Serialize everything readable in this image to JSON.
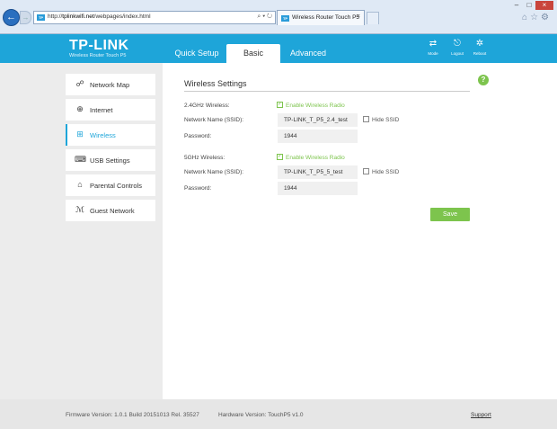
{
  "browser": {
    "url_prefix": "http://",
    "url_domain": "tplinkwifi.net",
    "url_path": "/webpages/index.html",
    "address_icons": "⌕ ▾ ↻",
    "tab_title": "Wireless Router Touch P5",
    "tab_close": "×",
    "favicon_text": "TP",
    "back_glyph": "←",
    "forward_glyph": "→",
    "window_buttons": [
      "–",
      "□",
      "×"
    ],
    "tool_icons": [
      "home-icon",
      "star-icon",
      "gear-icon"
    ]
  },
  "header": {
    "logo": "TP-LINK",
    "subtitle": "Wireless Router Touch P5",
    "tabs": [
      {
        "label": "Quick Setup",
        "active": false
      },
      {
        "label": "Basic",
        "active": true
      },
      {
        "label": "Advanced",
        "active": false
      }
    ],
    "actions": [
      {
        "label": "Mode",
        "icon": "mode-icon"
      },
      {
        "label": "Logout",
        "icon": "logout-icon"
      },
      {
        "label": "Reboot",
        "icon": "reboot-icon"
      }
    ]
  },
  "sidebar": {
    "items": [
      {
        "label": "Network Map",
        "icon": "network-map-icon",
        "active": false
      },
      {
        "label": "Internet",
        "icon": "globe-icon",
        "active": false
      },
      {
        "label": "Wireless",
        "icon": "wireless-icon",
        "active": true
      },
      {
        "label": "USB Settings",
        "icon": "usb-icon",
        "active": false
      },
      {
        "label": "Parental Controls",
        "icon": "parental-controls-icon",
        "active": false
      },
      {
        "label": "Guest Network",
        "icon": "guest-network-icon",
        "active": false
      }
    ]
  },
  "content": {
    "help_glyph": "?",
    "section_title": "Wireless Settings",
    "band_24": {
      "label": "2.4GHz Wireless:",
      "enable_label": "Enable Wireless Radio",
      "enabled": true,
      "ssid_label": "Network Name (SSID):",
      "ssid_value": "TP-LINK_T_P5_2.4_test",
      "hide_ssid_label": "Hide SSID",
      "hide_ssid": false,
      "password_label": "Password:",
      "password_value": "1944"
    },
    "band_5": {
      "label": "5GHz Wireless:",
      "enable_label": "Enable Wireless Radio",
      "enabled": true,
      "ssid_label": "Network Name (SSID):",
      "ssid_value": "TP-LINK_T_P5_5_test",
      "hide_ssid_label": "Hide SSID",
      "hide_ssid": false,
      "password_label": "Password:",
      "password_value": "1944"
    },
    "save_label": "Save"
  },
  "footer": {
    "firmware": "Firmware Version: 1.0.1 Build 20151013 Rel. 35527",
    "hardware": "Hardware Version: TouchP5 v1.0",
    "support": "Support"
  },
  "colors": {
    "brand_blue": "#1ea5d9",
    "accent_green": "#7dc44d"
  }
}
